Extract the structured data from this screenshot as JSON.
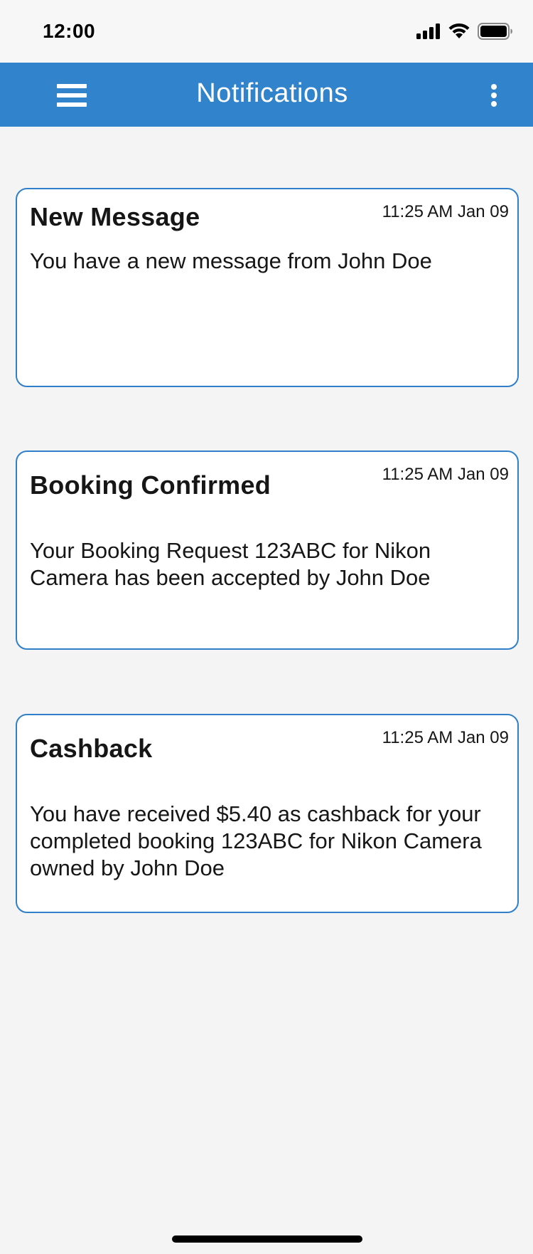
{
  "status_bar": {
    "time": "12:00",
    "icons": [
      "signal-icon",
      "wifi-icon",
      "battery-icon"
    ]
  },
  "app_bar": {
    "title": "Notifications",
    "menu_icon": "hamburger-menu-icon",
    "more_icon": "more-vertical-icon",
    "background_color": "#3183cc"
  },
  "notifications": [
    {
      "title": "New Message",
      "time": "11:25 AM Jan 09",
      "body": "You have a new message from John Doe"
    },
    {
      "title": "Booking Confirmed",
      "time": "11:25 AM Jan 09",
      "body": "Your Booking Request 123ABC for Nikon Camera has been accepted by John Doe"
    },
    {
      "title": "Cashback",
      "time": "11:25 AM Jan 09",
      "body": "You have received $5.40 as cashback for your completed booking 123ABC for Nikon Camera owned by John Doe"
    }
  ],
  "colors": {
    "accent": "#3183cc",
    "card_border": "#2f7fcb",
    "page_background": "#f4f4f4"
  }
}
